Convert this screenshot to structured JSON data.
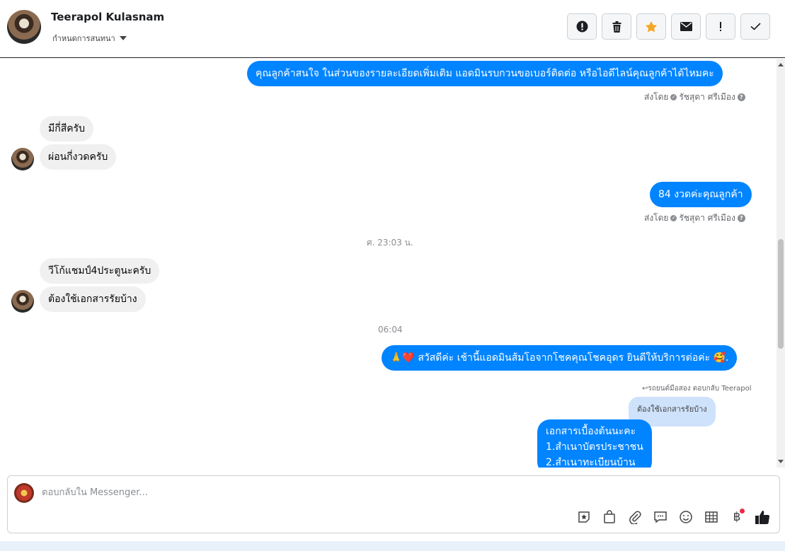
{
  "header": {
    "name": "Teerapol Kulasnam",
    "subtitle": "กำหนดการสนทนา",
    "actions": [
      "alert-circle-icon",
      "trash-icon",
      "star-icon",
      "envelope-icon",
      "exclamation-icon",
      "check-icon"
    ]
  },
  "messages": {
    "m1": "คุณลูกค้าสนใจ ในส่วนของรายละเอียดเพิ่มเติม แอดมินรบกวนขอเบอร์ติดต่อ หรือไอดีไลน์คุณลูกค้าได้ไหมคะ",
    "sent_by_1": "ส่งโดย",
    "agent_1": "รัชสุดา ศรีเมือง",
    "m2": "มีกี่สีครับ",
    "m3": "ผ่อนกี่งวดครับ",
    "m4": "84 งวดค่ะคุณลูกค้า",
    "sent_by_2": "ส่งโดย",
    "agent_2": "รัชสุดา ศรีเมือง",
    "time_1": "ศ. 23:03 น.",
    "m5": "วีโก้แชมป์4ประตูนะครับ",
    "m6": "ต้องใช้เอกสารรัยบ้าง",
    "time_2": "06:04",
    "m7": "🙏❤️ สวัสดีค่ะ เช้านี้แอดมินส้มโอจากโชคคุณโชคอุดร ยินดีให้บริการต่อค่ะ 🥰.",
    "reply_label": "↩รถยนต์มือสอง ตอบกลับ Teerapol",
    "quoted": "ต้องใช้เอกสารรัยบ้าง",
    "m8_line1": "เอกสารเบื้องต้นนะคะ",
    "m8_line2": "1.สำเนาบัตรประชาชน",
    "m8_line3": "2.สำเนาทะเบียนบ้าน"
  },
  "composer": {
    "placeholder": "ตอบกลับใน Messenger...",
    "tools": [
      "sticker-icon",
      "shopping-bag-icon",
      "paperclip-icon",
      "saved-replies-icon",
      "emoji-icon",
      "table-icon",
      "baht-icon",
      "like-icon"
    ]
  },
  "colors": {
    "outgoing": "#0084ff",
    "incoming": "#f0f0f0",
    "star": "#f5a623"
  }
}
